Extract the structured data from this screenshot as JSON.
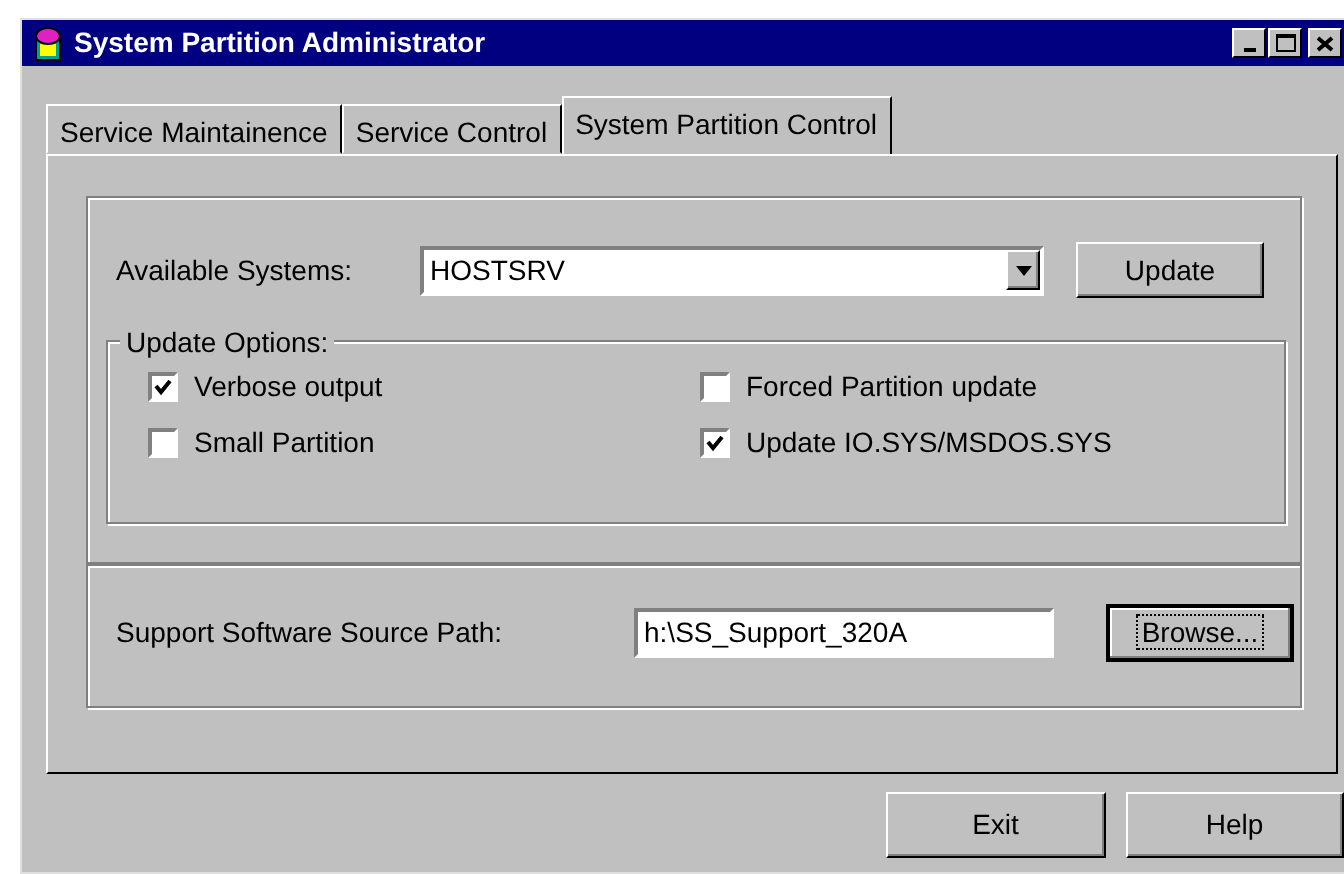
{
  "window": {
    "title": "System Partition Administrator",
    "controls": [
      {
        "kind": "minimize"
      },
      {
        "kind": "maximize"
      },
      {
        "kind": "close"
      }
    ]
  },
  "tabs": [
    {
      "label": "Service Maintainence",
      "selected": false
    },
    {
      "label": "Service Control",
      "selected": false
    },
    {
      "label": "System Partition Control",
      "selected": true
    }
  ],
  "systems": {
    "label": "Available Systems:",
    "value": "HOSTSRV",
    "button": {
      "label": "Update"
    }
  },
  "update_options": {
    "title": "Update Options:",
    "options": [
      {
        "label": "Verbose output",
        "checked": true
      },
      {
        "label": "Forced Partition update",
        "checked": false
      },
      {
        "label": "Small Partition",
        "checked": false
      },
      {
        "label": "Update IO.SYS/MSDOS.SYS",
        "checked": true
      }
    ]
  },
  "source_path": {
    "label": "Support Software Source Path:",
    "value": "h:\\SS_Support_320A",
    "button": {
      "label": "Browse...",
      "focused": true
    }
  },
  "buttons": [
    {
      "label": "Exit"
    },
    {
      "label": "Help"
    }
  ]
}
